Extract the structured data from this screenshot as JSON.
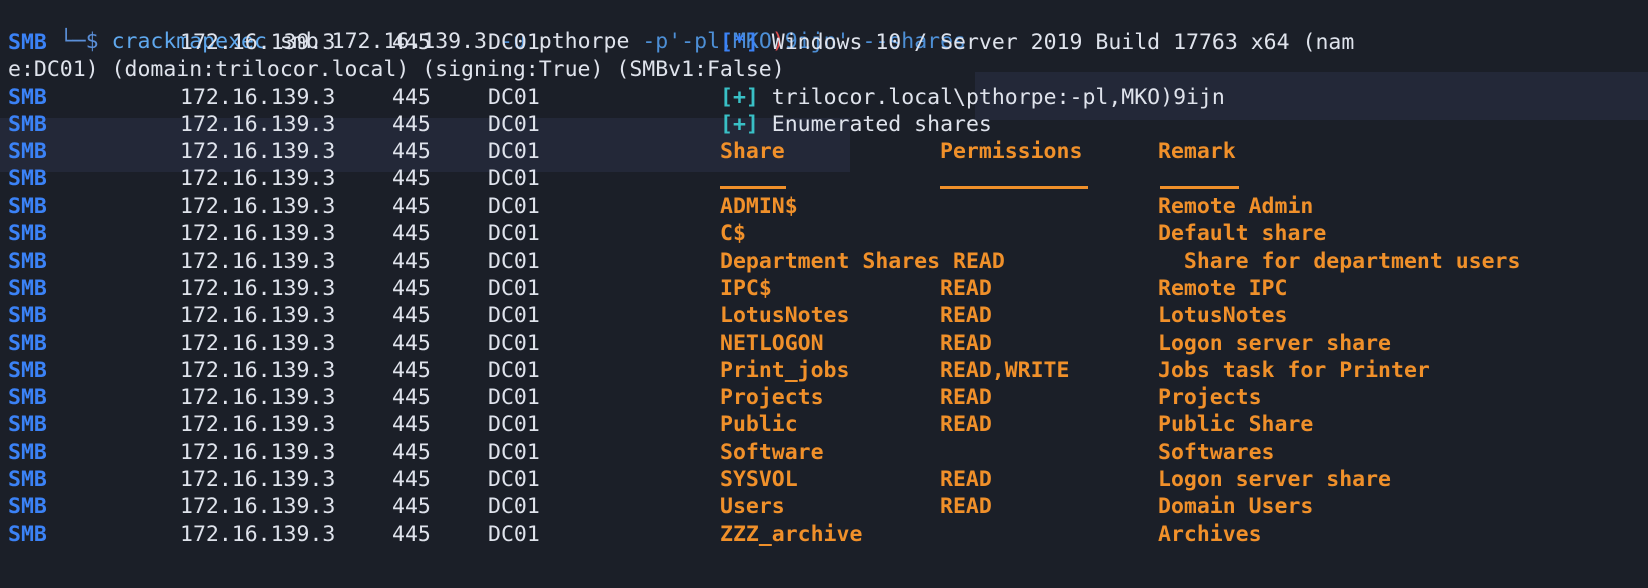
{
  "prompt": {
    "arrow": "└─$",
    "command": "crackmapexec",
    "arg1": "smb 172.16.139.3",
    "user_flag": "-u",
    "user": "pthorpe",
    "pass_flag": "-p'-pl,MKO",
    "pass_red": ")",
    "pass_rest": "9ijn'",
    "shares_flag": "--shares"
  },
  "info_line": {
    "tag": "[*]",
    "text": "Windows 10 / Server 2019 Build 17763 x64 (nam",
    "wrap": "e:DC01) (domain:trilocor.local) (signing:True) (SMBv1:False)"
  },
  "auth_line": {
    "tag": "[+]",
    "text": "trilocor.local\\pthorpe:-pl,MKO)9ijn"
  },
  "enum_line": {
    "tag": "[+]",
    "text": "Enumerated shares"
  },
  "host": {
    "proto": "SMB",
    "ip": "172.16.139.3",
    "port": "445",
    "name": "DC01"
  },
  "table": {
    "headers": {
      "share": "Share",
      "permissions": "Permissions",
      "remark": "Remark"
    },
    "rows": [
      {
        "share": "ADMIN$",
        "perm": "",
        "remark": "Remote Admin"
      },
      {
        "share": "C$",
        "perm": "",
        "remark": "Default share"
      },
      {
        "share": "Department Shares READ",
        "perm": "",
        "remark": "  Share for department users"
      },
      {
        "share": "IPC$",
        "perm": "READ",
        "remark": "Remote IPC"
      },
      {
        "share": "LotusNotes",
        "perm": "READ",
        "remark": "LotusNotes"
      },
      {
        "share": "NETLOGON",
        "perm": "READ",
        "remark": "Logon server share"
      },
      {
        "share": "Print_jobs",
        "perm": "READ,WRITE",
        "remark": "Jobs task for Printer"
      },
      {
        "share": "Projects",
        "perm": "READ",
        "remark": "Projects"
      },
      {
        "share": "Public",
        "perm": "READ",
        "remark": "Public Share"
      },
      {
        "share": "Software",
        "perm": "",
        "remark": "Softwares"
      },
      {
        "share": "SYSVOL",
        "perm": "READ",
        "remark": "Logon server share"
      },
      {
        "share": "Users",
        "perm": "READ",
        "remark": "Domain Users"
      },
      {
        "share": "ZZZ_archive",
        "perm": "",
        "remark": "Archives"
      }
    ]
  },
  "colors": {
    "background": "#1b1f28",
    "smb_blue": "#3b82f6",
    "share_orange": "#f0902a",
    "plus_cyan": "#39c0c6",
    "text": "#dfe3ec"
  }
}
